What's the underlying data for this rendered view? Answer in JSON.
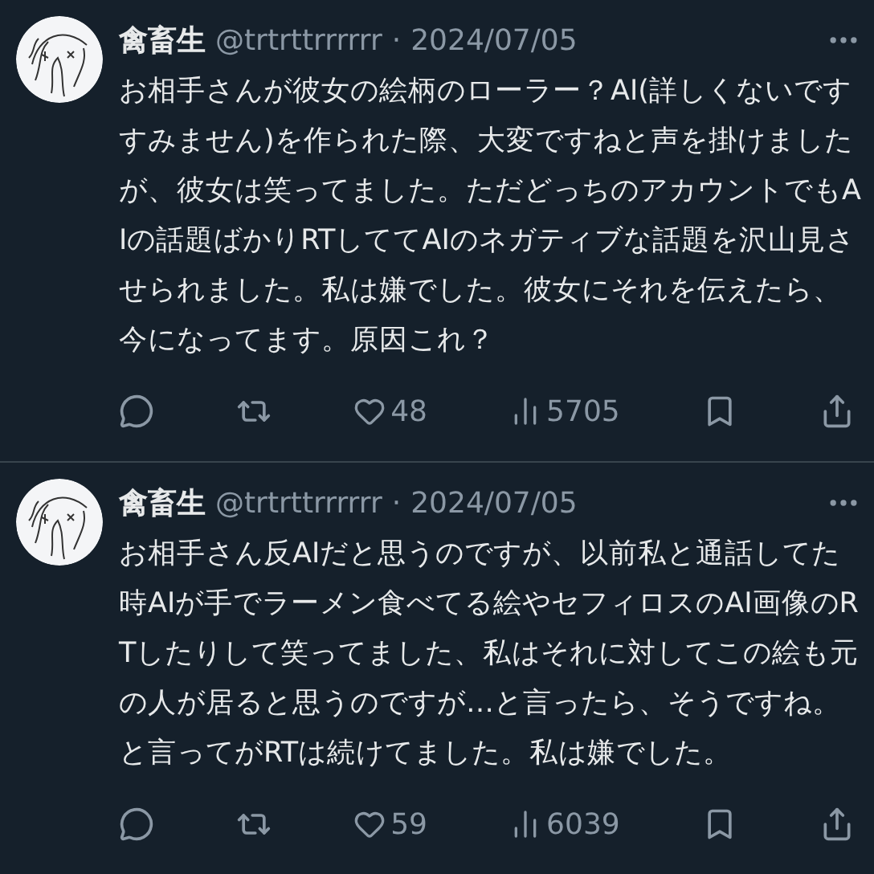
{
  "tweets": [
    {
      "name": "禽畜生",
      "handle": "@trtrttrrrrrr",
      "separator": "·",
      "date": "2024/07/05",
      "text": "お相手さんが彼女の絵柄のローラー？AI(詳しくないですすみません)を作られた際、大変ですねと声を掛けましたが、彼女は笑ってました。ただどっちのアカウントでもAIの話題ばかりRTしててAIのネガティブな話題を沢山見させられました。私は嫌でした。彼女にそれを伝えたら、今になってます。原因これ？",
      "likes": "48",
      "views": "5705"
    },
    {
      "name": "禽畜生",
      "handle": "@trtrttrrrrrr",
      "separator": "·",
      "date": "2024/07/05",
      "text": "お相手さん反AIだと思うのですが、以前私と通話してた時AIが手でラーメン食べてる絵やセフィロスのAI画像のRTしたりして笑ってました、私はそれに対してこの絵も元の人が居ると思うのですが…と言ったら、そうですね。と言ってがRTは続けてました。私は嫌でした。",
      "likes": "59",
      "views": "6039"
    }
  ]
}
